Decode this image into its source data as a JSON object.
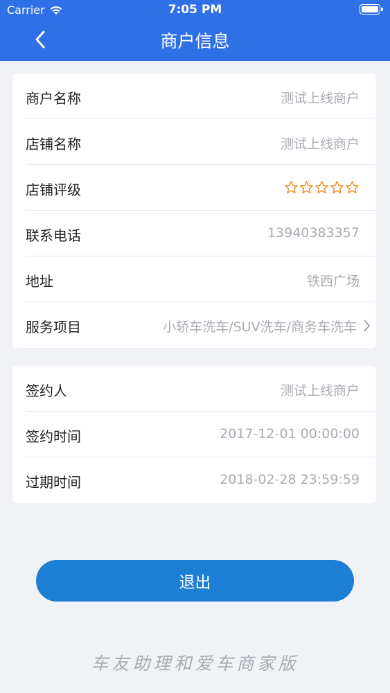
{
  "status_bar": {
    "carrier": "Carrier",
    "time": "7:05 PM"
  },
  "nav": {
    "title": "商户信息"
  },
  "merchant_info": [
    {
      "label": "商户名称",
      "value": "测试上线商户"
    },
    {
      "label": "店铺名称",
      "value": "测试上线商户"
    },
    {
      "label": "店铺评级",
      "rating": 0,
      "max_rating": 5
    },
    {
      "label": "联系电话",
      "value": "13940383357"
    },
    {
      "label": "地址",
      "value": "铁西广场"
    },
    {
      "label": "服务项目",
      "value": "小轿车洗车/SUV洗车/商务车洗车"
    }
  ],
  "contract_info": [
    {
      "label": "签约人",
      "value": "测试上线商户"
    },
    {
      "label": "签约时间",
      "value": "2017-12-01 00:00:00"
    },
    {
      "label": "过期时间",
      "value": "2018-02-28 23:59:59"
    }
  ],
  "logout_label": "退出",
  "footer_text": "车友助理和爱车商家版",
  "colors": {
    "header": "#2f70e6",
    "button": "#1c7ed5",
    "star": "#e88a1a",
    "background": "#f1f2f6"
  }
}
